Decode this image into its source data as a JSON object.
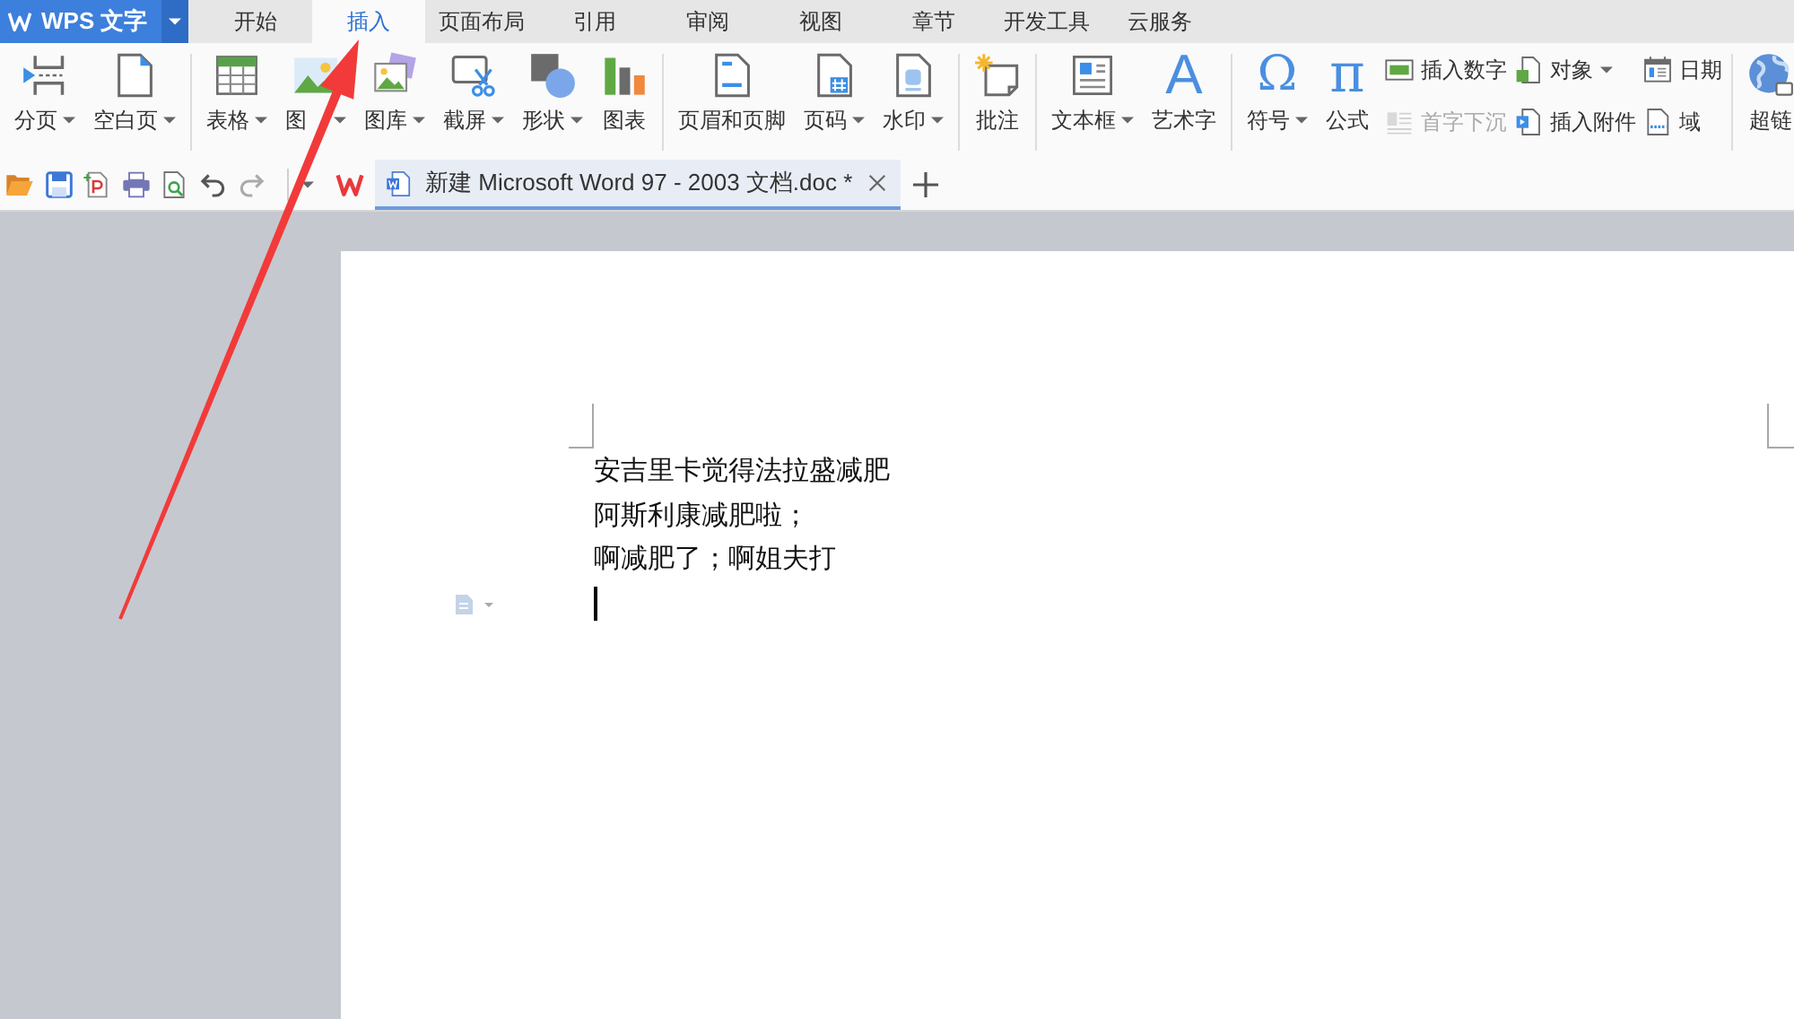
{
  "app_menu": {
    "label": "WPS 文字"
  },
  "tabs": [
    {
      "label": "开始",
      "selected": false
    },
    {
      "label": "插入",
      "selected": true
    },
    {
      "label": "页面布局",
      "selected": false
    },
    {
      "label": "引用",
      "selected": false
    },
    {
      "label": "审阅",
      "selected": false
    },
    {
      "label": "视图",
      "selected": false
    },
    {
      "label": "章节",
      "selected": false
    },
    {
      "label": "开发工具",
      "selected": false
    },
    {
      "label": "云服务",
      "selected": false
    }
  ],
  "ribbon": {
    "groups": [
      {
        "items": [
          {
            "label": "分页",
            "dropdown": true
          },
          {
            "label": "空白页",
            "dropdown": true
          }
        ]
      },
      {
        "items": [
          {
            "label": "表格",
            "dropdown": true
          },
          {
            "label": "图",
            "dropdown": true
          },
          {
            "label": "图库",
            "dropdown": true
          },
          {
            "label": "截屏",
            "dropdown": true
          },
          {
            "label": "形状",
            "dropdown": true
          },
          {
            "label": "图表",
            "dropdown": false
          }
        ]
      },
      {
        "items": [
          {
            "label": "页眉和页脚",
            "dropdown": false
          },
          {
            "label": "页码",
            "dropdown": true
          },
          {
            "label": "水印",
            "dropdown": true
          }
        ]
      },
      {
        "items": [
          {
            "label": "批注",
            "dropdown": false
          }
        ]
      },
      {
        "items": [
          {
            "label": "文本框",
            "dropdown": true
          },
          {
            "label": "艺术字",
            "dropdown": false,
            "glyph": "A"
          }
        ]
      },
      {
        "items": [
          {
            "label": "符号",
            "dropdown": true,
            "glyph": "Ω"
          },
          {
            "label": "公式",
            "dropdown": false,
            "glyph": "π"
          }
        ],
        "small_items": [
          {
            "label": "插入数字",
            "dropdown": false,
            "disabled": false
          },
          {
            "label": "首字下沉",
            "dropdown": false,
            "disabled": true
          },
          {
            "label": "对象",
            "dropdown": true,
            "disabled": false
          },
          {
            "label": "插入附件",
            "dropdown": false,
            "disabled": false
          },
          {
            "label": "日期",
            "dropdown": false,
            "disabled": false
          },
          {
            "label": "域",
            "dropdown": false,
            "disabled": false
          }
        ]
      },
      {
        "items": [
          {
            "label": "超链",
            "dropdown": false
          }
        ]
      }
    ]
  },
  "document_tabs": [
    {
      "title": "新建 Microsoft Word 97 - 2003 文档.doc *",
      "selected": true
    }
  ],
  "document": {
    "paragraphs": [
      "安吉里卡觉得法拉盛减肥",
      "阿斯利康减肥啦；",
      "啊减肥了；啊姐夫打"
    ]
  }
}
